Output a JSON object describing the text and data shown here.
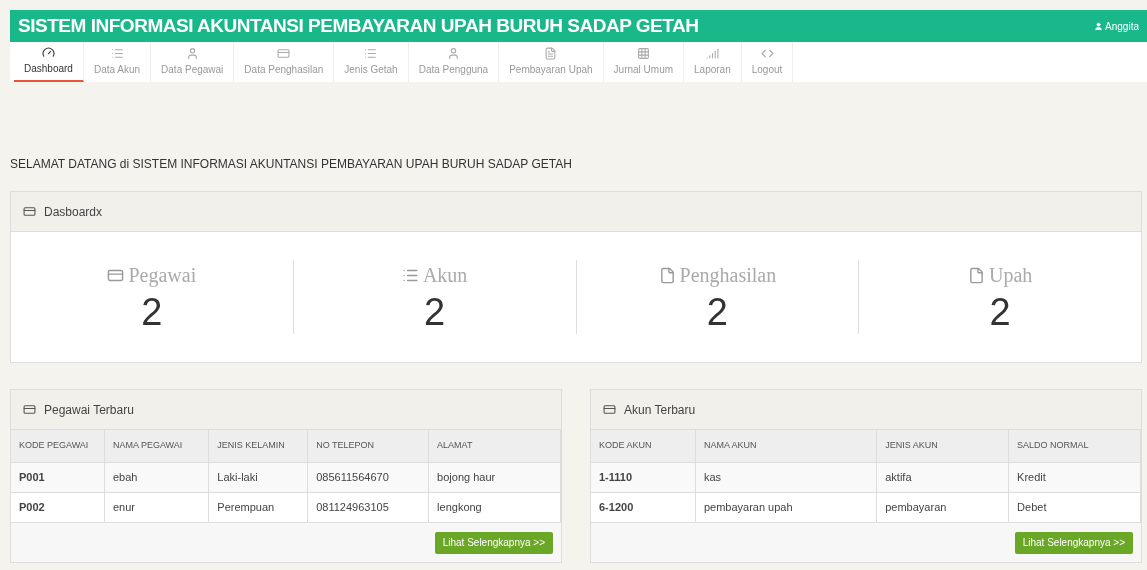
{
  "header": {
    "title": "SISTEM INFORMASI AKUNTANSI PEMBAYARAN UPAH BURUH SADAP GETAH",
    "user": "Anggita"
  },
  "nav": [
    {
      "label": "Dashboard",
      "selected": true
    },
    {
      "label": "Data Akun",
      "selected": false
    },
    {
      "label": "Data Pegawai",
      "selected": false
    },
    {
      "label": "Data Penghasilan",
      "selected": false
    },
    {
      "label": "Jenis Getah",
      "selected": false
    },
    {
      "label": "Data Pengguna",
      "selected": false
    },
    {
      "label": "Pembayaran Upah",
      "selected": false
    },
    {
      "label": "Jurnal Umum",
      "selected": false
    },
    {
      "label": "Laporan",
      "selected": false
    },
    {
      "label": "Logout",
      "selected": false
    }
  ],
  "welcome": "SELAMAT DATANG di SISTEM INFORMASI AKUNTANSI PEMBAYARAN UPAH BURUH SADAP GETAH",
  "dashboard": {
    "title": "Dasboardx",
    "stats": [
      {
        "label": "Pegawai",
        "value": "2"
      },
      {
        "label": "Akun",
        "value": "2"
      },
      {
        "label": "Penghasilan",
        "value": "2"
      },
      {
        "label": "Upah",
        "value": "2"
      }
    ]
  },
  "tables": [
    {
      "title": "Pegawai Terbaru",
      "columns": [
        "KODE PEGAWAI",
        "NAMA PEGAWAI",
        "JENIS KELAMIN",
        "NO TELEPON",
        "ALAMAT"
      ],
      "rows": [
        [
          "P001",
          "ebah",
          "Laki-laki",
          "085611564670",
          "bojong haur"
        ],
        [
          "P002",
          "enur",
          "Perempuan",
          "081124963105",
          "lengkong"
        ]
      ],
      "button": "Lihat Selengkapnya >>"
    },
    {
      "title": "Akun Terbaru",
      "columns": [
        "KODE AKUN",
        "NAMA AKUN",
        "JENIS AKUN",
        "SALDO NORMAL"
      ],
      "rows": [
        [
          "1-1110",
          "kas",
          "aktifa",
          "Kredit"
        ],
        [
          "6-1200",
          "pembayaran upah",
          "pembayaran",
          "Debet"
        ]
      ],
      "button": "Lihat Selengkapnya >>"
    }
  ]
}
